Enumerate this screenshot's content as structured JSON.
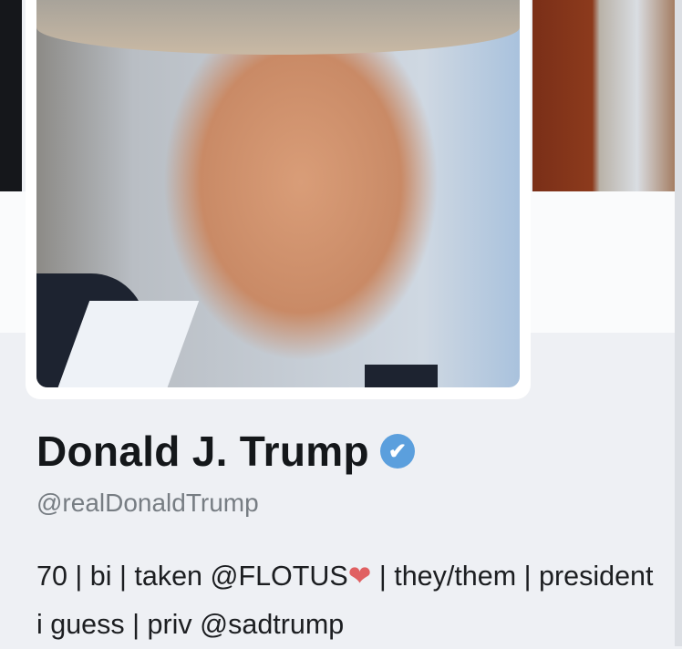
{
  "profile": {
    "name": "Donald J. Trump",
    "handle": "@realDonaldTrump",
    "verified": true,
    "bio": {
      "part1": "70 | bi | taken ",
      "mention1": "@FLOTUS",
      "heart": "❤",
      "part2": " | they/them | president i guess | priv ",
      "mention2": "@sadtrump"
    }
  },
  "icons": {
    "verified": "✔"
  },
  "colors": {
    "verified": "#5b9fdd",
    "heart": "#e06062"
  }
}
